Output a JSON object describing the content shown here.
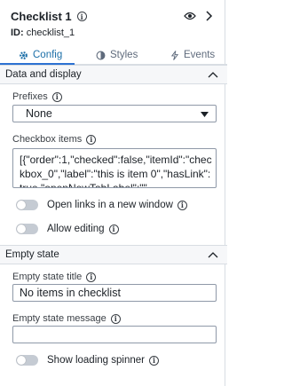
{
  "header": {
    "title": "Checklist 1",
    "id_label": "ID:",
    "id_value": "checklist_1"
  },
  "tabs": [
    {
      "label": "Config",
      "active": true
    },
    {
      "label": "Styles",
      "active": false
    },
    {
      "label": "Events",
      "active": false
    }
  ],
  "sections": {
    "data_display": {
      "title": "Data and display",
      "prefixes": {
        "label": "Prefixes",
        "value": "None"
      },
      "checkbox_items": {
        "label": "Checkbox items",
        "value": "[{\"order\":1,\"checked\":false,\"itemId\":\"checkbox_0\",\"label\":\"this is item 0\",\"hasLink\":true,\"openNewTabLabel\":\"\""
      },
      "open_links_new_window": {
        "label": "Open links in a new window",
        "on": false
      },
      "allow_editing": {
        "label": "Allow editing",
        "on": false
      }
    },
    "empty_state": {
      "title": "Empty state",
      "empty_title": {
        "label": "Empty state title",
        "value": "No items in checklist"
      },
      "empty_message": {
        "label": "Empty state message",
        "value": ""
      },
      "show_loading_spinner": {
        "label": "Show loading spinner",
        "on": false
      }
    }
  },
  "colors": {
    "accent": "#2d72d2",
    "border": "#d8dde3",
    "section_bg": "#f6f7f9"
  }
}
